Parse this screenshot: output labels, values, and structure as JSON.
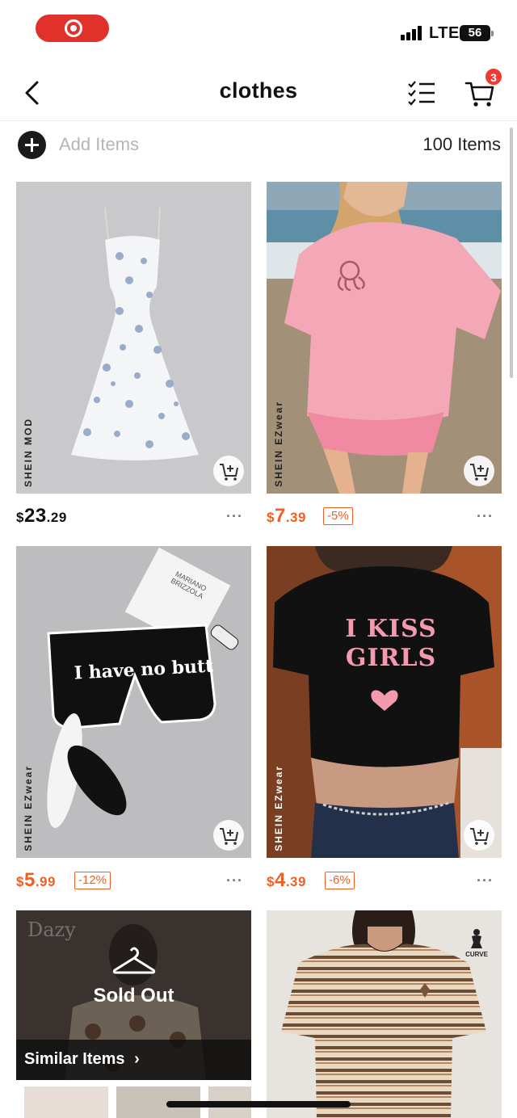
{
  "status": {
    "network": "LTE",
    "battery": "56"
  },
  "header": {
    "title": "clothes",
    "cart_count": "3"
  },
  "toolbar": {
    "add_label": "Add Items",
    "count_label": "100 Items"
  },
  "products": [
    {
      "brand": "SHEIN MOD",
      "price_cur": "$",
      "price_int": "23",
      "price_dec": ".29",
      "discount": "",
      "sale": false
    },
    {
      "brand": "SHEIN EZwear",
      "price_cur": "$",
      "price_int": "7",
      "price_dec": ".39",
      "discount": "-5%",
      "sale": true
    },
    {
      "brand": "SHEIN EZwear",
      "price_cur": "$",
      "price_int": "5",
      "price_dec": ".99",
      "discount": "-12%",
      "sale": true,
      "print_text": "I have no butt",
      "note_text": "MARIANO BRIZZOLA"
    },
    {
      "brand": "SHEIN EZwear",
      "price_cur": "$",
      "price_int": "4",
      "price_dec": ".39",
      "discount": "-6%",
      "sale": true,
      "print_line1": "I KISS",
      "print_line2": "GIRLS"
    }
  ],
  "sold_out_card": {
    "brand": "Dazy",
    "label": "Sold Out",
    "similar_label": "Similar Items",
    "chevron": "›"
  },
  "curve_card": {
    "badge": "CURVE"
  },
  "more_dots": "···"
}
